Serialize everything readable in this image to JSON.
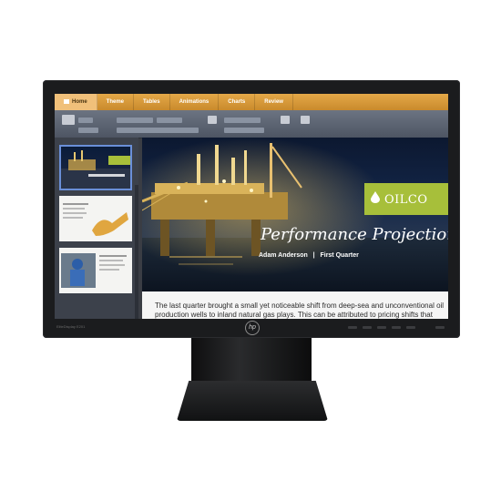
{
  "ribbon": {
    "tabs": [
      "Home",
      "Theme",
      "Tables",
      "Animations",
      "Charts",
      "Review"
    ],
    "active_tab": "Home"
  },
  "slide": {
    "title": "Performance Projections",
    "presenter": "Adam Anderson",
    "separator": "|",
    "quarter": "First Quarter",
    "brand": "OILCO"
  },
  "notes": {
    "text": "The last quarter brought a small yet noticeable shift from deep-sea and unconventional oil production wells to inland natural gas plays. This can be attributed to pricing shifts that enhanced"
  },
  "monitor": {
    "logo": "hp"
  },
  "colors": {
    "ribbon_orange": "#d99a3c",
    "brand_green": "#a7bf3a",
    "bezel": "#1b1c1e"
  }
}
